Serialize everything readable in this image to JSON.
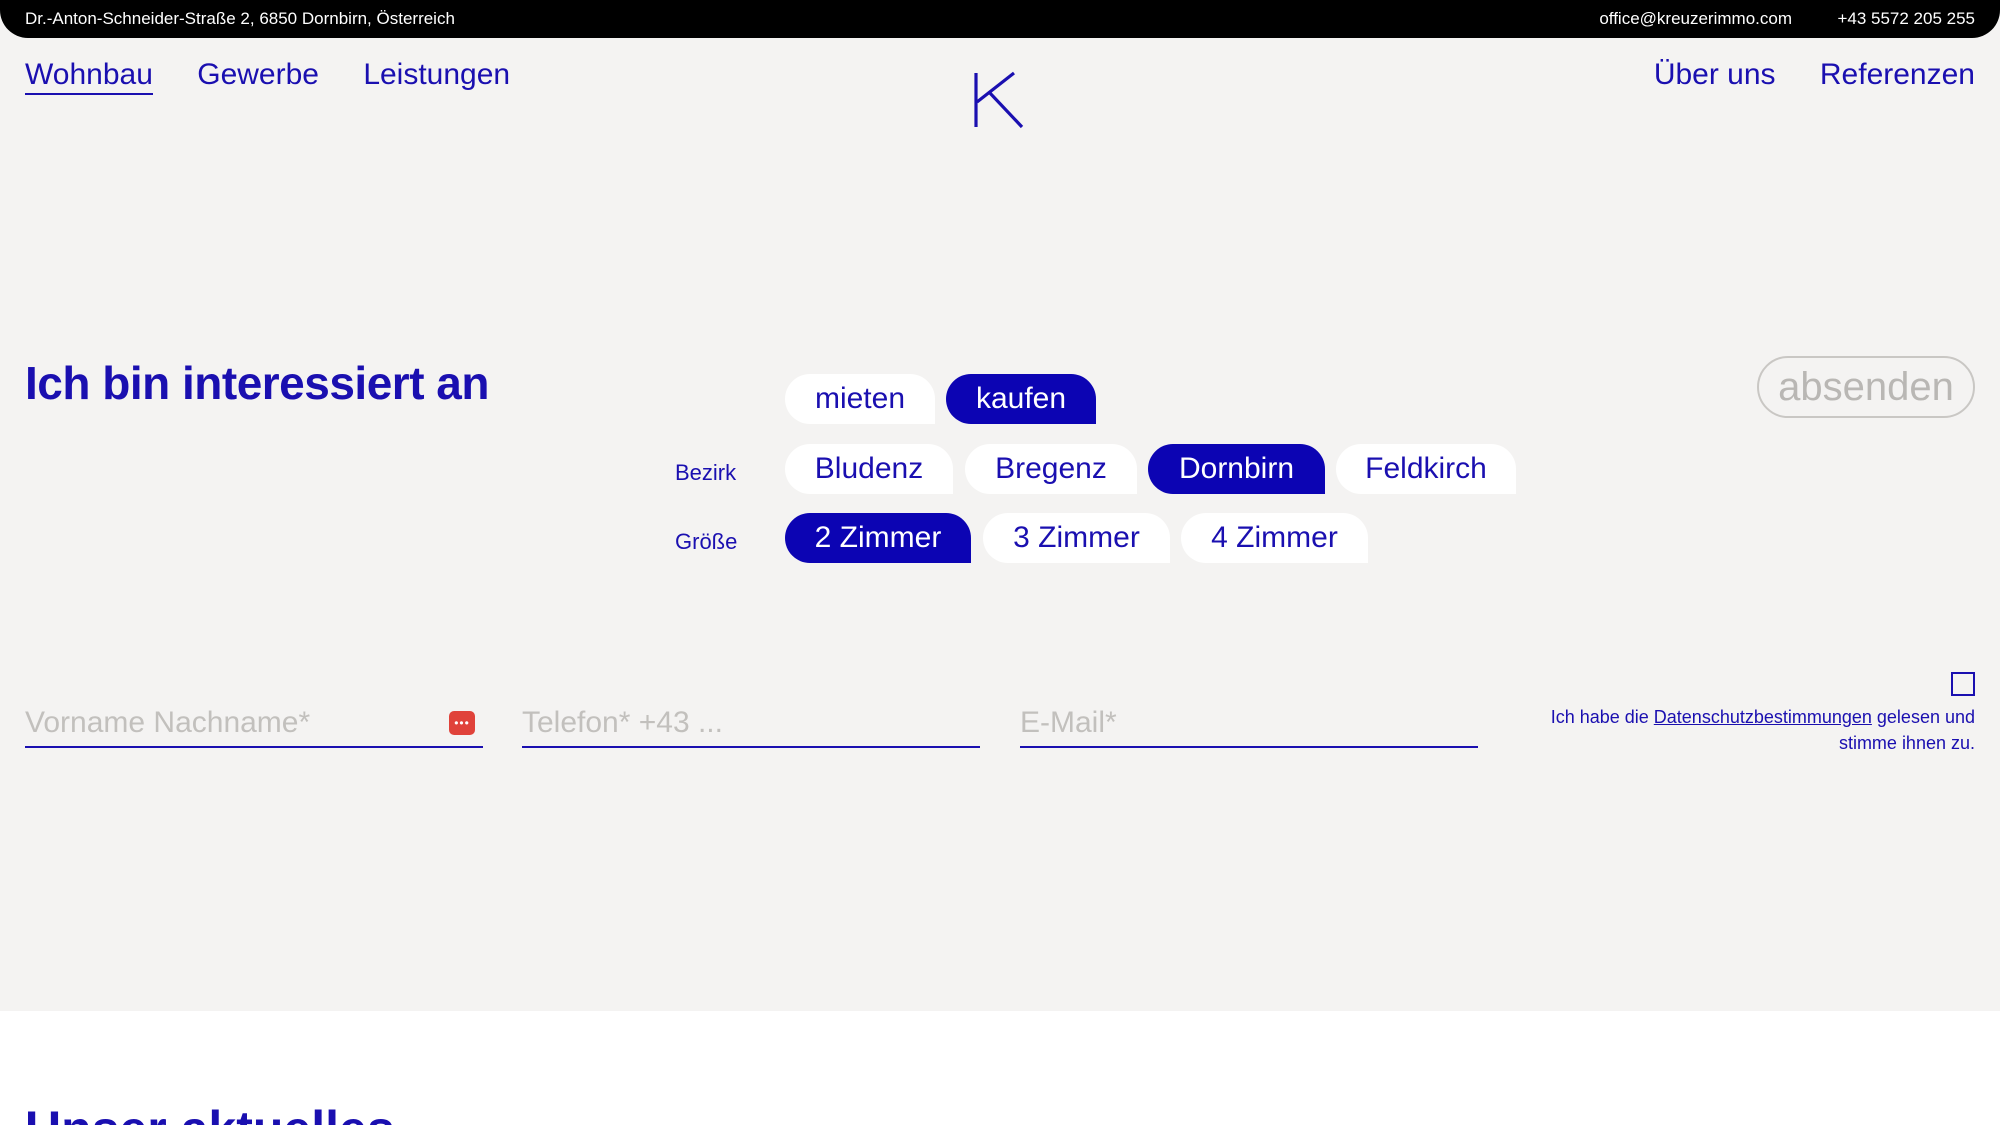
{
  "topbar": {
    "address": "Dr.-Anton-Schneider-Straße 2, 6850 Dornbirn, Österreich",
    "email": "office@kreuzerimmo.com",
    "phone": "+43 5572 205 255"
  },
  "nav": {
    "left": [
      {
        "label": "Wohnbau",
        "active": true
      },
      {
        "label": "Gewerbe",
        "active": false
      },
      {
        "label": "Leistungen",
        "active": false
      }
    ],
    "right": [
      {
        "label": "Über uns"
      },
      {
        "label": "Referenzen"
      }
    ],
    "logo": "K"
  },
  "form": {
    "headline": "Ich bin interessiert an",
    "submit_label": "absenden",
    "intent": {
      "options": [
        "mieten",
        "kaufen"
      ],
      "selected": "kaufen"
    },
    "bezirk": {
      "label": "Bezirk",
      "options": [
        "Bludenz",
        "Bregenz",
        "Dornbirn",
        "Feldkirch"
      ],
      "selected": "Dornbirn"
    },
    "groesse": {
      "label": "Größe",
      "options": [
        "2 Zimmer",
        "3 Zimmer",
        "4 Zimmer"
      ],
      "selected": "2 Zimmer"
    },
    "fields": {
      "name_placeholder": "Vorname Nachname*",
      "phone_placeholder": "Telefon* +43 ...",
      "email_placeholder": "E-Mail*"
    },
    "consent": {
      "prefix": "Ich habe die ",
      "link": "Datenschutzbestimmungen",
      "suffix": " gelesen und stimme ihnen zu."
    },
    "password_manager_icon_text": "•••"
  },
  "next_section": {
    "heading": "Unser aktuelles"
  },
  "colors": {
    "accent": "#0c04b3",
    "text": "#1a0fb0",
    "background": "#f4f3f2",
    "topbar": "#000000"
  }
}
